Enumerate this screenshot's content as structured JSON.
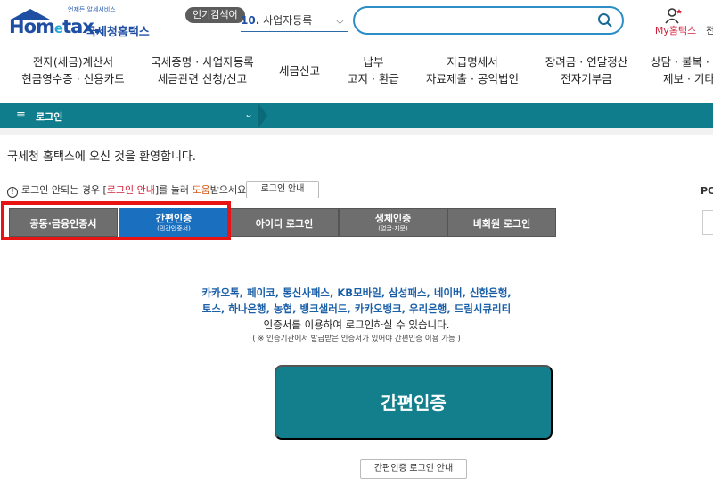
{
  "header": {
    "logo_tagline": "언제든 알세서비스",
    "logo_word_a": "Hom",
    "logo_word_e": "e",
    "logo_word_b": "tax.",
    "logo_kname": "국세청홈택스",
    "popular_badge": "인기검색어",
    "popular_num": "10.",
    "popular_term": "사업자등록",
    "search_placeholder": "",
    "myhome_label": "My홈택스",
    "edge_char": "전"
  },
  "nav": {
    "items": [
      {
        "line1": "전자(세금)계산서",
        "line2": "현금영수증 · 신용카드"
      },
      {
        "line1": "국세증명 · 사업자등록",
        "line2": "세금관련 신청/신고"
      },
      {
        "line1": "세금신고",
        "line2": ""
      },
      {
        "line1": "납부",
        "line2": "고지 · 환급"
      },
      {
        "line1": "지급명세서",
        "line2": "자료제출 · 공익법인"
      },
      {
        "line1": "장려금 · 연말정산",
        "line2": "전자기부금"
      },
      {
        "line1": "상담 · 불복 · 고",
        "line2": "제보 · 기타"
      }
    ]
  },
  "subbar": {
    "menu_icon": "≡",
    "breadcrumb": "로그인",
    "chevron": "⌄"
  },
  "welcome": "국세청 홈택스에 오신 것을 환영합니다.",
  "notice": {
    "icon": "!",
    "pre": "로그인 안되는 경우 [",
    "link": "로그인 안내",
    "mid": "]를 눌러 ",
    "help": "도움",
    "post": "받으세요.",
    "guide_button": "로그인 안내"
  },
  "right_edge": {
    "po": "PC"
  },
  "tabs": [
    {
      "label": "공동·금융인증서",
      "sub": ""
    },
    {
      "label": "간편인증",
      "sub": "(민간인증서)"
    },
    {
      "label": "아이디 로그인",
      "sub": ""
    },
    {
      "label": "생체인증",
      "sub": "(얼굴·지문)"
    },
    {
      "label": "비회원 로그인",
      "sub": ""
    }
  ],
  "active_tab": 1,
  "content": {
    "providers_line1": "카카오톡, 페이코, 통신사패스, KB모바일, 삼성패스, 네이버, 신한은행,",
    "providers_line2": "토스, 하나은행, 농협, 뱅크샐러드, 카카오뱅크, 우리은행, 드림시큐리티",
    "providers_line3": "인증서를 이용하여 로그인하실 수 있습니다.",
    "note": "( ※ 인증기관에서 발급받은 인증서가 있어야 간편인증 이용 가능 )",
    "easy_button": "간편인증",
    "easy_guide_button": "간편인증 로그인 안내"
  },
  "colors": {
    "brand_blue": "#1f4fa3",
    "teal": "#0f7d8c",
    "active_tab": "#1a6fbf",
    "highlight": "#e81414"
  }
}
